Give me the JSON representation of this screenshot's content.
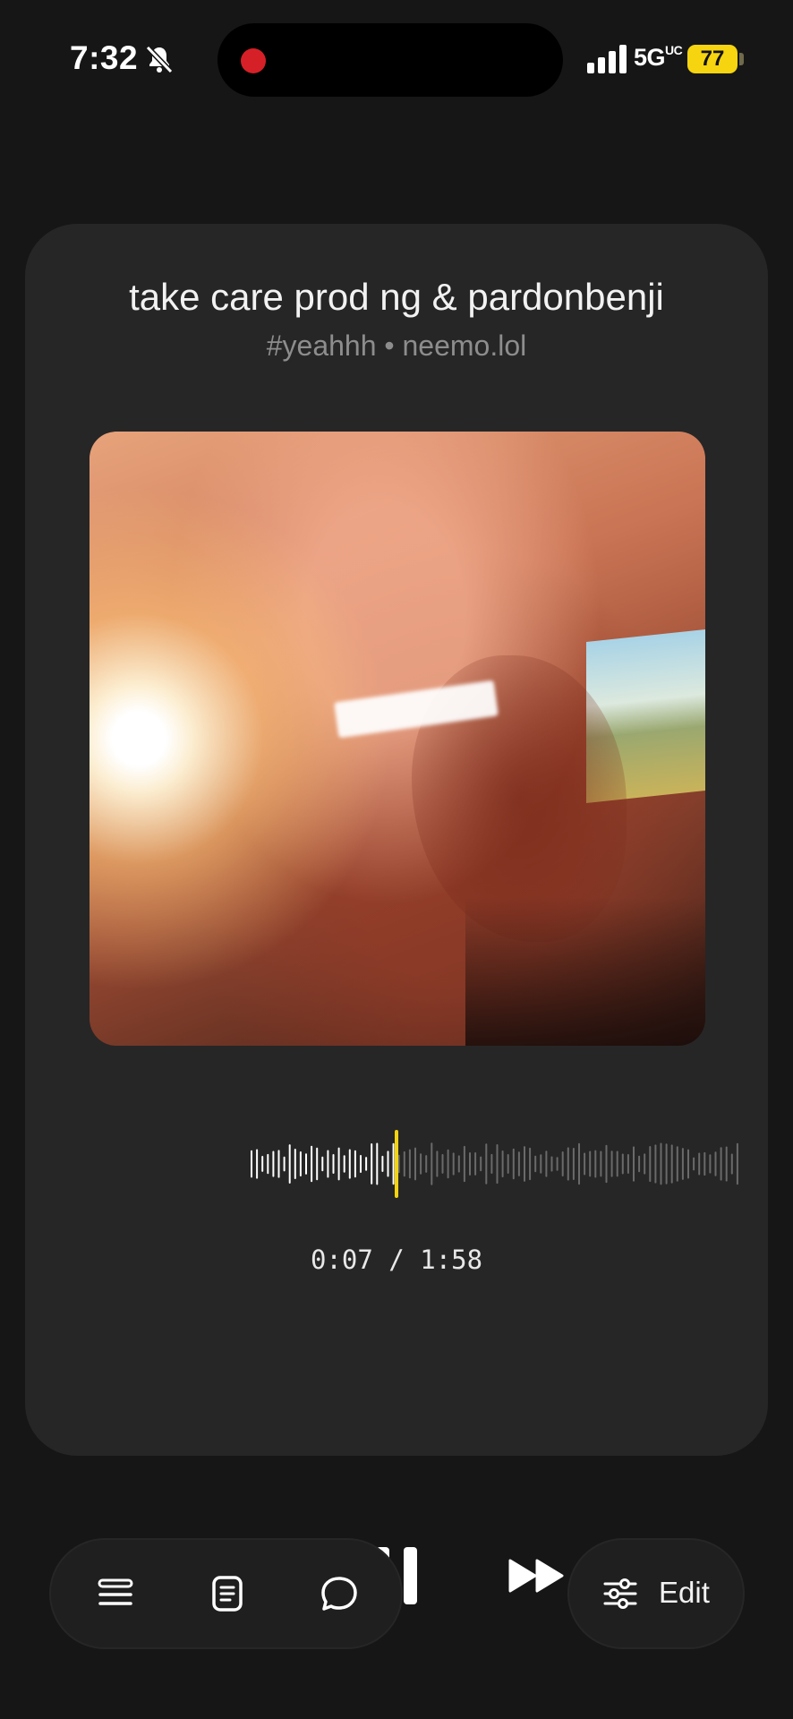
{
  "status_bar": {
    "time": "7:32",
    "network": "5G",
    "network_suffix": "UC",
    "battery": "77"
  },
  "player": {
    "title": "take care prod ng & pardonbenji",
    "subtitle": "#yeahhh • neemo.lol",
    "elapsed": "0:07",
    "duration": "1:58",
    "time_separator": " / ",
    "progress": 0.059,
    "accent_color": "#f2d410"
  },
  "controls": {
    "share_icon": "share-icon",
    "rewind_icon": "rewind-icon",
    "pause_icon": "pause-icon",
    "forward_icon": "fast-forward-icon",
    "repeat_icon": "repeat-icon"
  },
  "bottom_bar": {
    "left_icons": [
      "queue-icon",
      "lyrics-icon",
      "comment-icon"
    ],
    "edit_label": "Edit"
  },
  "colors": {
    "background": "#161616",
    "card": "#262626",
    "recording_dot": "#d62027",
    "battery": "#f6d40f"
  }
}
